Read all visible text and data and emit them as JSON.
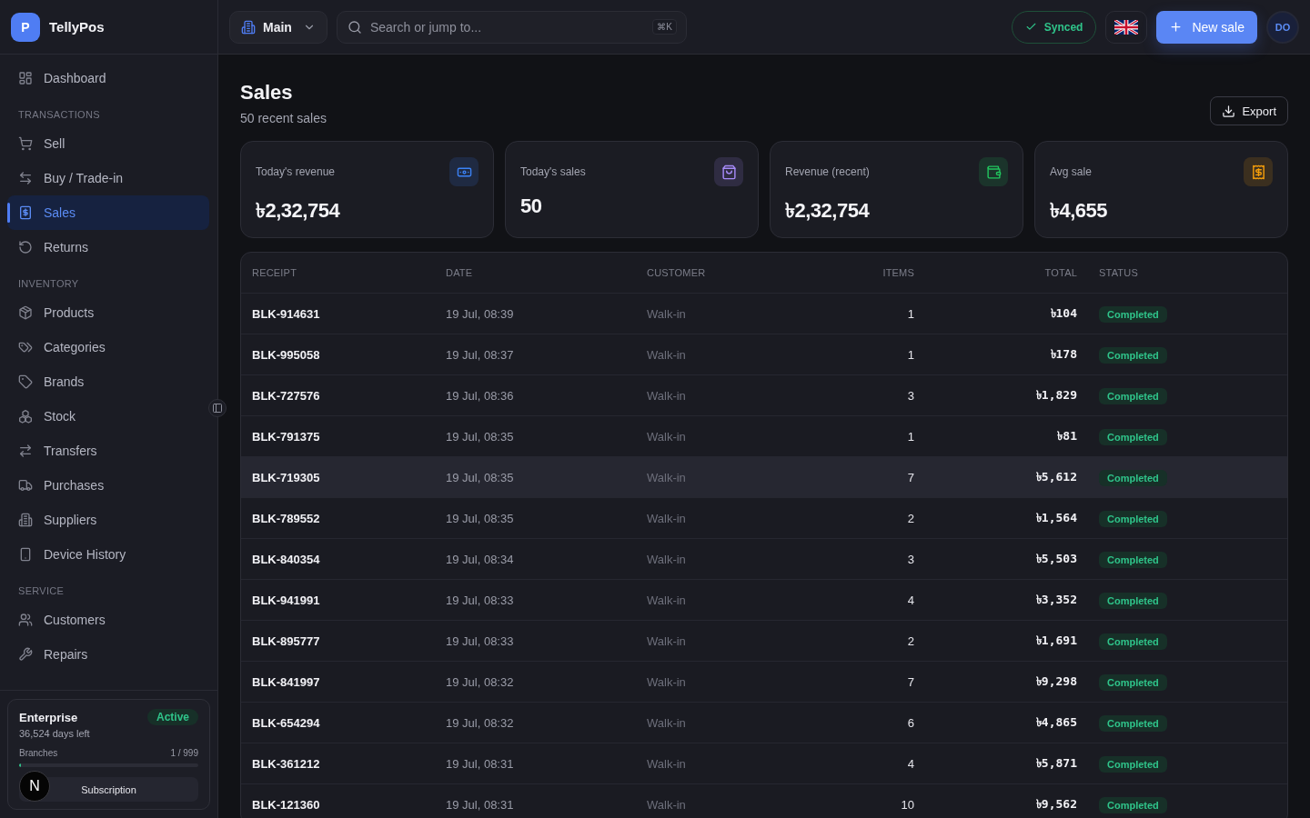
{
  "app": {
    "logo_letter": "P",
    "name": "TellyPos"
  },
  "sidebar": {
    "items": [
      {
        "label": "Dashboard",
        "selected": false
      }
    ],
    "sections": [
      {
        "title": "TRANSACTIONS",
        "items": [
          {
            "label": "Sell",
            "selected": false
          },
          {
            "label": "Buy / Trade-in",
            "selected": false
          },
          {
            "label": "Sales",
            "selected": true
          },
          {
            "label": "Returns",
            "selected": false
          }
        ]
      },
      {
        "title": "INVENTORY",
        "items": [
          {
            "label": "Products",
            "selected": false
          },
          {
            "label": "Categories",
            "selected": false
          },
          {
            "label": "Brands",
            "selected": false
          },
          {
            "label": "Stock",
            "selected": false
          },
          {
            "label": "Transfers",
            "selected": false
          },
          {
            "label": "Purchases",
            "selected": false
          },
          {
            "label": "Suppliers",
            "selected": false
          },
          {
            "label": "Device History",
            "selected": false
          }
        ]
      },
      {
        "title": "SERVICE",
        "items": [
          {
            "label": "Customers",
            "selected": false
          },
          {
            "label": "Repairs",
            "selected": false
          }
        ]
      }
    ]
  },
  "plan": {
    "name": "Enterprise",
    "status": "Active",
    "days_left": "36,524 days left",
    "usage_label": "Branches",
    "usage_value": "1 / 999",
    "level": 0.01,
    "button": "Subscription"
  },
  "dev_badge": {
    "letter": "N"
  },
  "topbar": {
    "branch": "Main",
    "search_placeholder": "Search or jump to...",
    "shortcut": "⌘K",
    "sync_status": "Synced",
    "new_sale": "New sale",
    "avatar": "DO"
  },
  "page": {
    "title": "Sales",
    "subtitle": "50 recent sales",
    "export": "Export"
  },
  "stats": [
    {
      "label": "Today's revenue",
      "value": "৳2,32,754",
      "color": "#3b82f6"
    },
    {
      "label": "Today's sales",
      "value": "50",
      "color": "#a78bfa"
    },
    {
      "label": "Revenue (recent)",
      "value": "৳2,32,754",
      "color": "#22c55e"
    },
    {
      "label": "Avg sale",
      "value": "৳4,655",
      "color": "#f59e0b"
    }
  ],
  "table": {
    "columns": [
      "RECEIPT",
      "DATE",
      "CUSTOMER",
      "ITEMS",
      "TOTAL",
      "STATUS"
    ],
    "rows": [
      {
        "receipt": "BLK-914631",
        "date": "19 Jul, 08:39",
        "customer": "Walk-in",
        "items": "1",
        "total": "৳104",
        "status": "Completed",
        "hovered": false
      },
      {
        "receipt": "BLK-995058",
        "date": "19 Jul, 08:37",
        "customer": "Walk-in",
        "items": "1",
        "total": "৳178",
        "status": "Completed",
        "hovered": false
      },
      {
        "receipt": "BLK-727576",
        "date": "19 Jul, 08:36",
        "customer": "Walk-in",
        "items": "3",
        "total": "৳1,829",
        "status": "Completed",
        "hovered": false
      },
      {
        "receipt": "BLK-791375",
        "date": "19 Jul, 08:35",
        "customer": "Walk-in",
        "items": "1",
        "total": "৳81",
        "status": "Completed",
        "hovered": false
      },
      {
        "receipt": "BLK-719305",
        "date": "19 Jul, 08:35",
        "customer": "Walk-in",
        "items": "7",
        "total": "৳5,612",
        "status": "Completed",
        "hovered": true
      },
      {
        "receipt": "BLK-789552",
        "date": "19 Jul, 08:35",
        "customer": "Walk-in",
        "items": "2",
        "total": "৳1,564",
        "status": "Completed",
        "hovered": false
      },
      {
        "receipt": "BLK-840354",
        "date": "19 Jul, 08:34",
        "customer": "Walk-in",
        "items": "3",
        "total": "৳5,503",
        "status": "Completed",
        "hovered": false
      },
      {
        "receipt": "BLK-941991",
        "date": "19 Jul, 08:33",
        "customer": "Walk-in",
        "items": "4",
        "total": "৳3,352",
        "status": "Completed",
        "hovered": false
      },
      {
        "receipt": "BLK-895777",
        "date": "19 Jul, 08:33",
        "customer": "Walk-in",
        "items": "2",
        "total": "৳1,691",
        "status": "Completed",
        "hovered": false
      },
      {
        "receipt": "BLK-841997",
        "date": "19 Jul, 08:32",
        "customer": "Walk-in",
        "items": "7",
        "total": "৳9,298",
        "status": "Completed",
        "hovered": false
      },
      {
        "receipt": "BLK-654294",
        "date": "19 Jul, 08:32",
        "customer": "Walk-in",
        "items": "6",
        "total": "৳4,865",
        "status": "Completed",
        "hovered": false
      },
      {
        "receipt": "BLK-361212",
        "date": "19 Jul, 08:31",
        "customer": "Walk-in",
        "items": "4",
        "total": "৳5,871",
        "status": "Completed",
        "hovered": false
      },
      {
        "receipt": "BLK-121360",
        "date": "19 Jul, 08:31",
        "customer": "Walk-in",
        "items": "10",
        "total": "৳9,562",
        "status": "Completed",
        "hovered": false
      }
    ]
  }
}
